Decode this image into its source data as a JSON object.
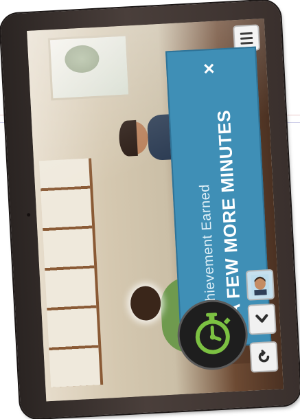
{
  "achievement": {
    "heading": "Achievement Earned",
    "title": "A FEW MORE MINUTES",
    "badge_icon": "stopwatch-icon",
    "banner_color": "#3f8fb6",
    "badge_color": "#7cc142"
  },
  "controls": {
    "close_icon": "close-icon",
    "menu_icon": "hamburger-menu-icon",
    "avatar_icon": "character-avatar-icon",
    "chevron_icon": "chevron-right-icon",
    "refresh_icon": "refresh-icon",
    "close_label": "×"
  }
}
